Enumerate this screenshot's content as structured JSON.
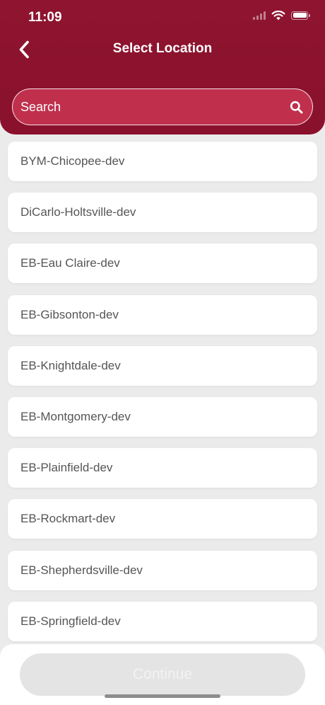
{
  "status_bar": {
    "time": "11:09",
    "icons": [
      "cellular-signal-icon",
      "wifi-icon",
      "battery-icon"
    ]
  },
  "nav": {
    "back_icon": "chevron-left-icon",
    "title": "Select Location"
  },
  "search": {
    "placeholder": "Search",
    "value": "",
    "icon": "search-icon"
  },
  "locations": [
    "BYM-Chicopee-dev",
    "DiCarlo-Holtsville-dev",
    "EB-Eau Claire-dev",
    "EB-Gibsonton-dev",
    "EB-Knightdale-dev",
    "EB-Montgomery-dev",
    "EB-Plainfield-dev",
    "EB-Rockmart-dev",
    "EB-Shepherdsville-dev",
    "EB-Springfield-dev"
  ],
  "footer": {
    "continue_label": "Continue",
    "continue_state": "disabled"
  },
  "colors": {
    "header": "#8e1430",
    "search_fill": "#c0304d",
    "background": "#ebebeb",
    "item_text": "#555555",
    "button_disabled": "#e4e4e4"
  }
}
